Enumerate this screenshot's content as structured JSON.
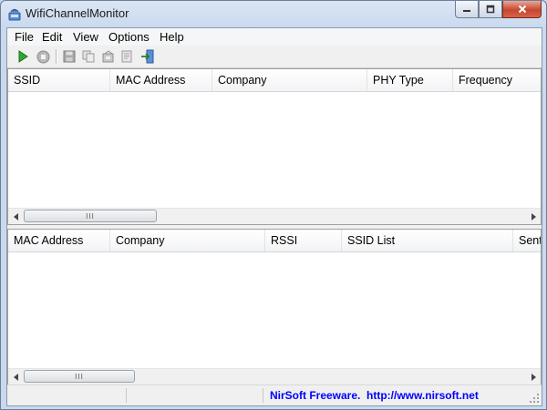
{
  "window": {
    "title": "WifiChannelMonitor"
  },
  "menu": [
    {
      "label": "File"
    },
    {
      "label": "Edit"
    },
    {
      "label": "View"
    },
    {
      "label": "Options"
    },
    {
      "label": "Help"
    }
  ],
  "toolbar": {
    "icons": [
      "start-icon",
      "stop-icon",
      "save-icon",
      "copy-icon",
      "properties-icon",
      "report-icon",
      "exit-icon"
    ]
  },
  "upper_list": {
    "columns": [
      "SSID",
      "MAC Address",
      "Company",
      "PHY Type",
      "Frequency"
    ],
    "rows": []
  },
  "lower_list": {
    "columns": [
      "MAC Address",
      "Company",
      "RSSI",
      "SSID List",
      "Sent"
    ],
    "rows": []
  },
  "scroll_thumb_label": "III",
  "status": {
    "text": "NirSoft Freeware.  http://www.nirsoft.net",
    "color": "#0000ff"
  }
}
